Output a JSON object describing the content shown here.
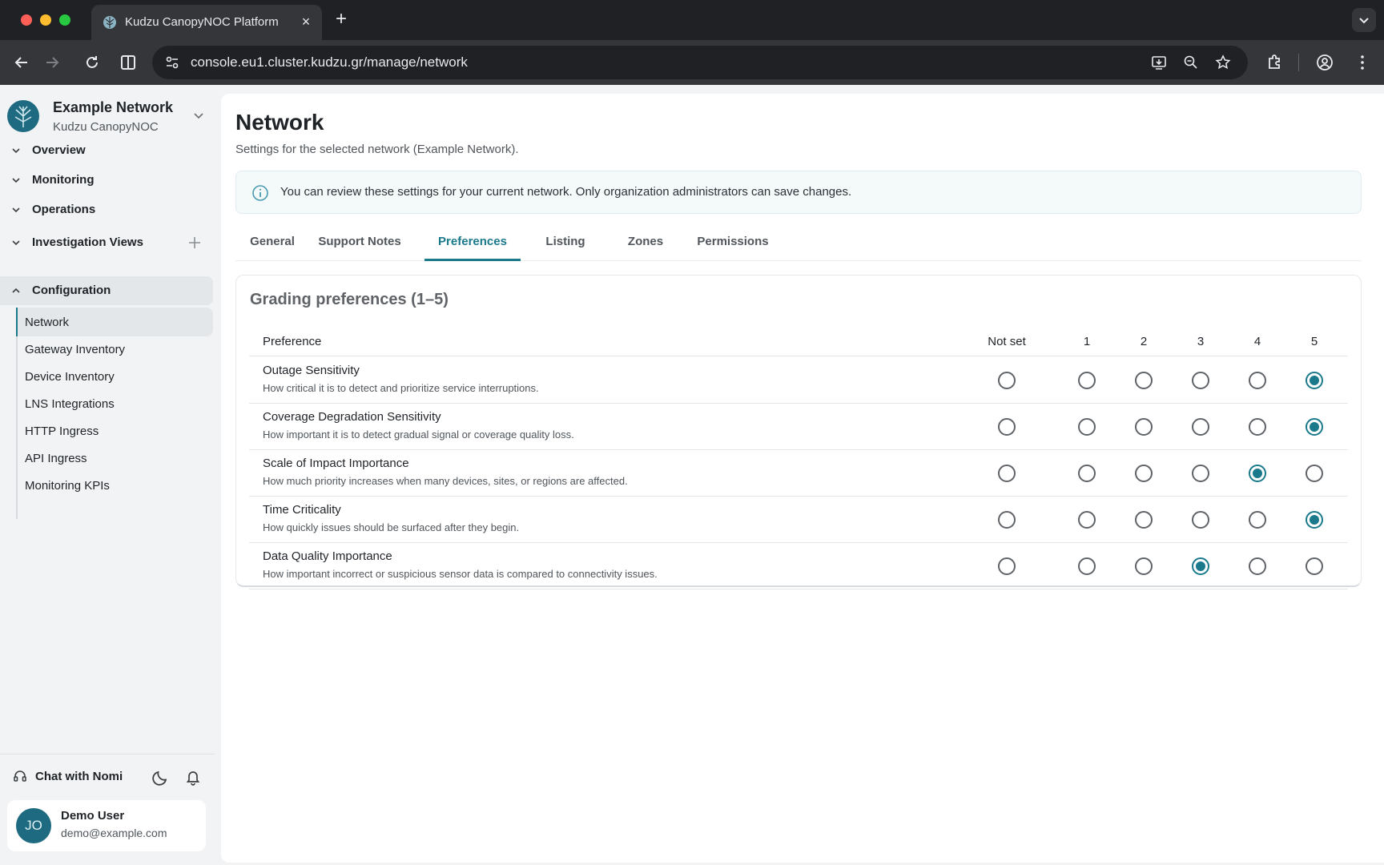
{
  "browser": {
    "tab_title": "Kudzu CanopyNOC Platform",
    "url": "console.eu1.cluster.kudzu.gr/manage/network"
  },
  "sidebar": {
    "network_name": "Example Network",
    "network_subtitle": "Kudzu CanopyNOC",
    "groups": [
      {
        "label": "Overview",
        "expanded": false
      },
      {
        "label": "Monitoring",
        "expanded": false
      },
      {
        "label": "Operations",
        "expanded": false
      },
      {
        "label": "Investigation Views",
        "expanded": false
      },
      {
        "label": "Configuration",
        "expanded": true
      }
    ],
    "config_items": [
      {
        "label": "Network",
        "active": true
      },
      {
        "label": "Gateway Inventory"
      },
      {
        "label": "Device Inventory"
      },
      {
        "label": "LNS Integrations"
      },
      {
        "label": "HTTP Ingress"
      },
      {
        "label": "API Ingress"
      },
      {
        "label": "Monitoring KPIs"
      }
    ],
    "chat_label": "Chat with Nomi",
    "user": {
      "initials": "JO",
      "name": "Demo User",
      "email": "demo@example.com"
    }
  },
  "main": {
    "title": "Network",
    "subtitle": "Settings for the selected network (Example Network).",
    "info_text": "You can review these settings for your current network. Only organization administrators can save changes.",
    "tabs": [
      "General",
      "Support Notes",
      "Preferences",
      "Listing",
      "Zones",
      "Permissions"
    ],
    "active_tab": "Preferences",
    "card_title": "Grading preferences (1–5)",
    "columns": [
      "Preference",
      "Not set",
      "1",
      "2",
      "3",
      "4",
      "5"
    ],
    "preferences": [
      {
        "name": "Outage Sensitivity",
        "description": "How critical it is to detect and prioritize service interruptions.",
        "value": "5"
      },
      {
        "name": "Coverage Degradation Sensitivity",
        "description": "How important it is to detect gradual signal or coverage quality loss.",
        "value": "5"
      },
      {
        "name": "Scale of Impact Importance",
        "description": "How much priority increases when many devices, sites, or regions are affected.",
        "value": "4"
      },
      {
        "name": "Time Criticality",
        "description": "How quickly issues should be surfaced after they begin.",
        "value": "5"
      },
      {
        "name": "Data Quality Importance",
        "description": "How important incorrect or suspicious sensor data is compared to connectivity issues.",
        "value": "3"
      }
    ]
  },
  "colors": {
    "accent": "#1a7a8c",
    "logo": "#1e6a80"
  }
}
